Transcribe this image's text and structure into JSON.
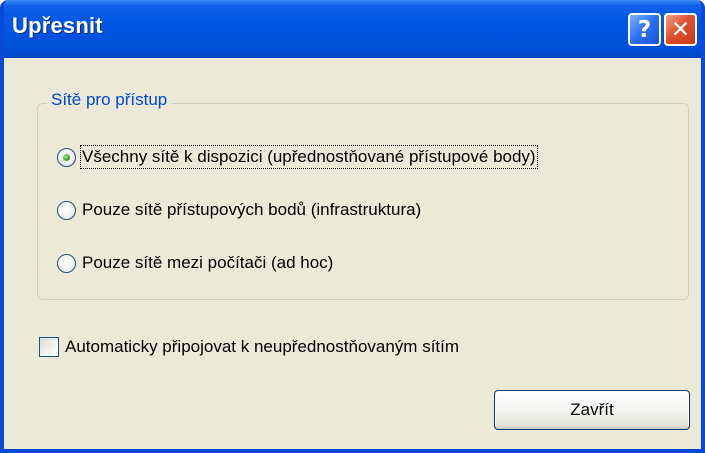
{
  "window": {
    "title": "Upřesnit"
  },
  "titlebar": {
    "help_icon": "?",
    "close_icon": "✕"
  },
  "group": {
    "label": "Sítě pro přístup",
    "options": [
      {
        "label": "Všechny sítě k dispozici (upřednostňované přístupové body)",
        "selected": true
      },
      {
        "label": "Pouze sítě přístupových bodů (infrastruktura)",
        "selected": false
      },
      {
        "label": "Pouze sítě mezi počítači (ad hoc)",
        "selected": false
      }
    ]
  },
  "options": {
    "auto_connect_label": "Automaticky připojovat k neupřednostňovaným sítím",
    "auto_connect_checked": false
  },
  "buttons": {
    "close_label": "Zavřít"
  },
  "colors": {
    "titlebar": "#0055e5",
    "dialog_bg": "#ece9d8",
    "group_label": "#0046d5",
    "close_button": "#e0512c"
  }
}
